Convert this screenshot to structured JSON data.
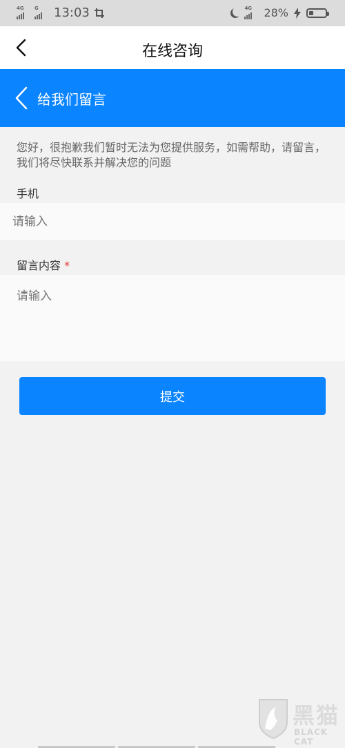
{
  "status_bar": {
    "sim1_network": "4G",
    "sim2_network": "G",
    "time": "13:03",
    "right_network": "4G",
    "battery_text": "28%",
    "battery_level": 0.28
  },
  "nav": {
    "title": "在线咨询"
  },
  "banner": {
    "title": "给我们留言"
  },
  "notice": "您好，很抱歉我们暂时无法为您提供服务，如需帮助，请留言，我们将尽快联系并解决您的问题",
  "phone": {
    "label": "手机",
    "placeholder": "请输入",
    "value": ""
  },
  "message": {
    "label": "留言内容",
    "required_mark": "*",
    "placeholder": "请输入",
    "value": ""
  },
  "submit_label": "提交",
  "watermark": {
    "chars": "黑猫",
    "latin": "BLACK CAT"
  },
  "colors": {
    "accent": "#0a84ff",
    "background": "#f2f2f2",
    "required": "#e53935"
  }
}
